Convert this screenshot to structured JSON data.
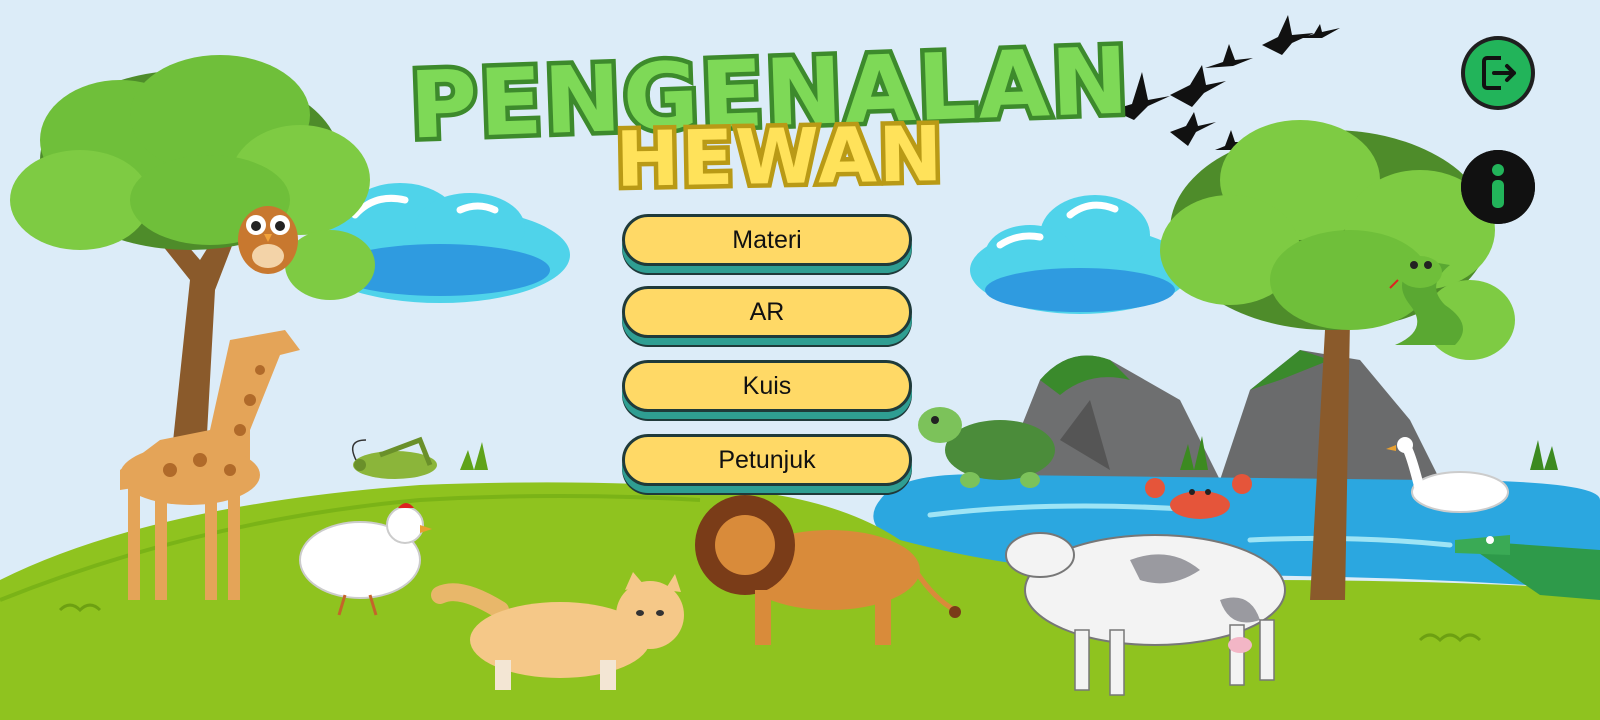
{
  "app": {
    "title_line1": "PENGENALAN",
    "title_line2": "HEWAN"
  },
  "menu": {
    "items": [
      {
        "label": "Materi"
      },
      {
        "label": "AR"
      },
      {
        "label": "Kuis"
      },
      {
        "label": "Petunjuk"
      }
    ]
  },
  "corner_buttons": {
    "exit_icon": "exit-icon",
    "info_icon": "info-icon"
  },
  "colors": {
    "sky": "#dcecf8",
    "grass": "#8fc31f",
    "button_fill": "#ffd966",
    "button_shadow": "#2f9e92",
    "title_green": "#7ed957",
    "title_yellow": "#ffe25a",
    "icon_green": "#22b45a"
  }
}
